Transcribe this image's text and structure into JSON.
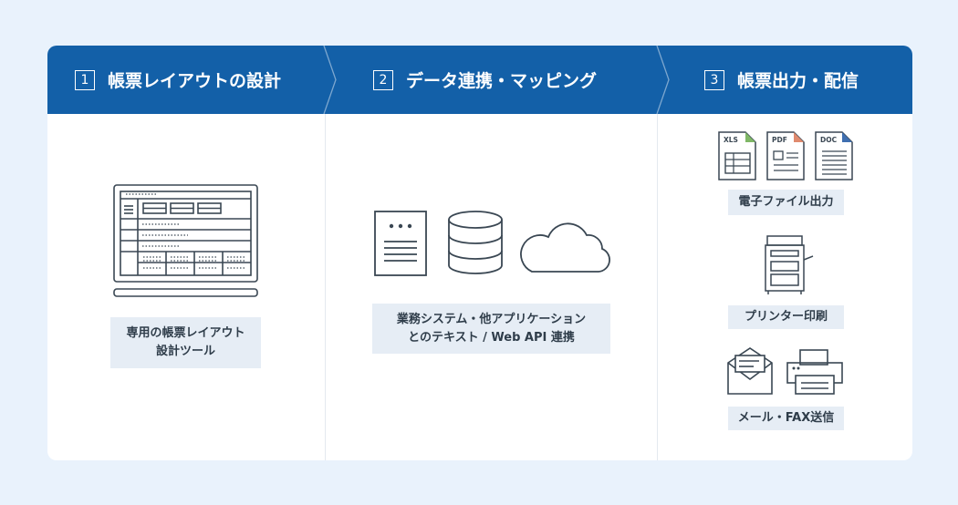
{
  "steps": [
    {
      "number": "1",
      "title": "帳票レイアウトの設計"
    },
    {
      "number": "2",
      "title": "データ連携・マッピング"
    },
    {
      "number": "3",
      "title": "帳票出力・配信"
    }
  ],
  "col1": {
    "caption_line1": "専用の帳票レイアウト",
    "caption_line2": "設計ツール"
  },
  "col2": {
    "caption_line1": "業務システム・他アプリケーション",
    "caption_line2": "とのテキスト / Web API 連携"
  },
  "col3": {
    "file_labels": [
      "XLS",
      "PDF",
      "DOC"
    ],
    "electronic_caption": "電子ファイル出力",
    "printer_caption": "プリンター印刷",
    "mail_fax_caption": "メール・FAX送信"
  },
  "colors": {
    "header": "#1360a8",
    "label_bg": "#e6edf5",
    "background": "#e9f2fc",
    "xls_accent": "#7fb766",
    "pdf_accent": "#e08a6e",
    "doc_accent": "#3f6fb0"
  }
}
